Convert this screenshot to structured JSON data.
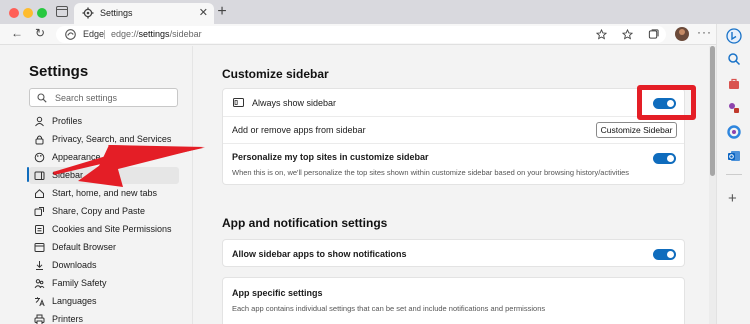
{
  "window": {
    "tab_title": "Settings",
    "tab_close": "✕",
    "new_tab": "+"
  },
  "toolbar": {
    "back": "←",
    "reload": "↻",
    "site_label": "Edge",
    "url_prefix": "edge://",
    "url_bold": "settings",
    "url_suffix": "/sidebar",
    "more": "···"
  },
  "nav": {
    "title": "Settings",
    "search_placeholder": "Search settings",
    "items": [
      {
        "label": "Profiles",
        "icon": "profile-icon"
      },
      {
        "label": "Privacy, Search, and Services",
        "icon": "lock-icon"
      },
      {
        "label": "Appearance",
        "icon": "appearance-icon"
      },
      {
        "label": "Sidebar",
        "icon": "sidebar-icon",
        "active": true
      },
      {
        "label": "Start, home, and new tabs",
        "icon": "home-icon"
      },
      {
        "label": "Share, Copy and Paste",
        "icon": "share-icon"
      },
      {
        "label": "Cookies and Site Permissions",
        "icon": "cookie-icon"
      },
      {
        "label": "Default Browser",
        "icon": "browser-icon"
      },
      {
        "label": "Downloads",
        "icon": "download-icon"
      },
      {
        "label": "Family Safety",
        "icon": "family-icon"
      },
      {
        "label": "Languages",
        "icon": "language-icon"
      },
      {
        "label": "Printers",
        "icon": "printer-icon"
      }
    ]
  },
  "main": {
    "customize": {
      "title": "Customize sidebar",
      "always_show": "Always show sidebar",
      "always_show_on": true,
      "add_remove": "Add or remove apps from sidebar",
      "customize_button": "Customize Sidebar",
      "personalize": "Personalize my top sites in customize sidebar",
      "personalize_desc": "When this is on, we'll personalize the top sites shown within customize sidebar based on your browsing history/activities",
      "personalize_on": true
    },
    "notifications": {
      "title": "App and notification settings",
      "allow": "Allow sidebar apps to show notifications",
      "allow_on": true,
      "app_specific": "App specific settings",
      "app_specific_desc": "Each app contains individual settings that can be set and include notifications and permissions"
    }
  },
  "colors": {
    "accent": "#0f6cbd",
    "highlight": "#e41e26"
  }
}
